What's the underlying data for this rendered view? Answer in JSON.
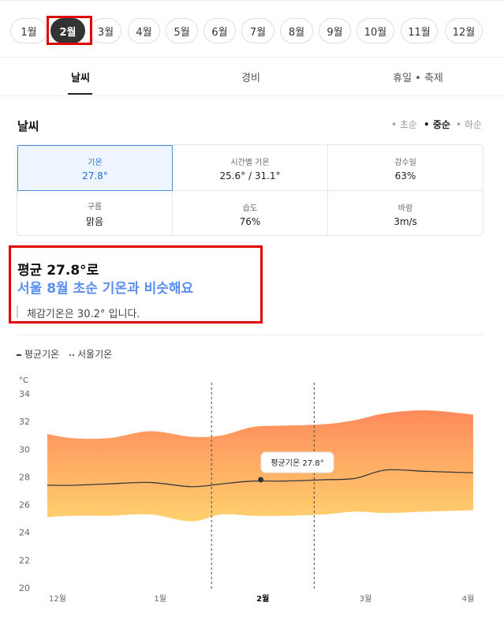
{
  "months": [
    "1월",
    "2월",
    "3월",
    "4월",
    "5월",
    "6월",
    "7월",
    "8월",
    "9월",
    "10월",
    "11월",
    "12월"
  ],
  "selected_month": "2월",
  "tabs": [
    {
      "label": "날씨",
      "active": true
    },
    {
      "label": "경비",
      "active": false
    },
    {
      "label": "휴일 • 축제",
      "active": false
    }
  ],
  "weather": {
    "title": "날씨",
    "periods": [
      "• 초순",
      "• 중순",
      "• 하순"
    ],
    "active_period": "• 중순",
    "cells": [
      {
        "label": "기온",
        "value": "27.8°",
        "active": true
      },
      {
        "label": "시간별 기온",
        "value": "25.6° / 31.1°",
        "active": false
      },
      {
        "label": "강수일",
        "value": "63%",
        "active": false
      },
      {
        "label": "구름",
        "value": "맑음",
        "active": false
      },
      {
        "label": "습도",
        "value": "76%",
        "active": false
      },
      {
        "label": "바람",
        "value": "3m/s",
        "active": false
      }
    ]
  },
  "summary": {
    "line1": "평균 27.8°로",
    "line2": "서울 8월 초순 기온과 비슷해요",
    "note": "체감기온은 30.2° 입니다."
  },
  "legend": {
    "avg": "평균기온",
    "seoul": "서울기온"
  },
  "colors": {
    "accent_blue": "#5b8ef0",
    "highlight_red": "#e00000",
    "band_top": "#ff8a5c",
    "band_bottom": "#ffd16e"
  },
  "chart_data": {
    "type": "area",
    "unit_label": "°C",
    "y_ticks": [
      34,
      32,
      30,
      28,
      26,
      24,
      22,
      20
    ],
    "ylim": [
      20,
      34
    ],
    "x_ticks": [
      {
        "label": "12월",
        "pos": 0,
        "bold": false
      },
      {
        "label": "1월",
        "pos": 1,
        "bold": false
      },
      {
        "label": "2월",
        "pos": 2,
        "bold": true
      },
      {
        "label": "3월",
        "pos": 3,
        "bold": false
      },
      {
        "label": "4월",
        "pos": 4,
        "bold": false
      }
    ],
    "xlim": [
      -0.1,
      4.05
    ],
    "x": [
      -0.1,
      0.15,
      0.5,
      0.9,
      1.3,
      1.6,
      1.9,
      2.2,
      2.6,
      2.9,
      3.2,
      3.6,
      4.05
    ],
    "high": [
      31.1,
      30.8,
      30.8,
      31.3,
      30.9,
      31.0,
      31.6,
      31.7,
      31.8,
      32.1,
      32.6,
      32.8,
      32.5
    ],
    "avg": [
      27.4,
      27.4,
      27.5,
      27.6,
      27.3,
      27.5,
      27.7,
      27.7,
      27.8,
      27.9,
      28.5,
      28.4,
      28.3
    ],
    "low": [
      25.1,
      25.2,
      25.2,
      25.3,
      24.8,
      25.3,
      25.2,
      25.2,
      25.3,
      25.5,
      25.4,
      25.5,
      25.6
    ],
    "marker": {
      "x": 1.98,
      "y": 27.8,
      "label": "평균기온 27.8°"
    },
    "dashed_lines_x": [
      1.5,
      2.5
    ],
    "grid": false
  }
}
